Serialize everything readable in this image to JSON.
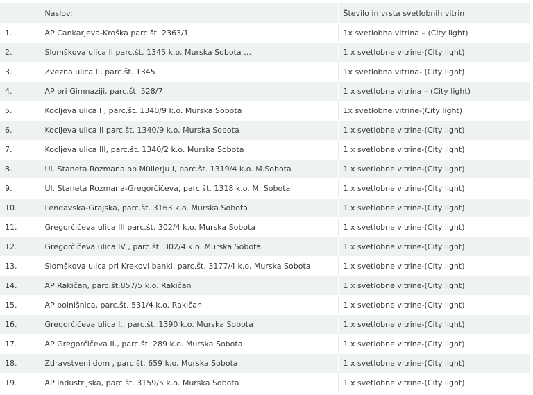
{
  "table": {
    "headers": [
      "",
      "Naslov:",
      "Število in vrsta svetlobnih vitrin"
    ],
    "rows": [
      [
        "1.",
        "AP Cankarjeva-Kroška parc.št. 2363/1",
        "1x svetlobna vitrina – (City light)"
      ],
      [
        "2.",
        "Slomškova ulica II parc.št. 1345 k.o. Murska Sobota …",
        "1 x svetlobne vitrine-(City light)"
      ],
      [
        "3.",
        "Zvezna ulica II, parc.št. 1345",
        "1x svetlobna vitrina- (City light)"
      ],
      [
        "4.",
        "AP pri Gimnaziji, parc.št. 528/7",
        "1 x svetlobna vitrina – (City light)"
      ],
      [
        "5.",
        "Kocljeva ulica I , parc.št. 1340/9 k.o. Murska Sobota",
        "1x svetlobne vitrine-(City light)"
      ],
      [
        "6.",
        "Kocljeva ulica II parc.št. 1340/9 k.o. Murska Sobota",
        "1 x svetlobne vitrine-(City light)"
      ],
      [
        "7.",
        "Kocljeva ulica III, parc.št. 1340/2 k.o. Murska Sobota",
        "1 x svetlobne vitrine-(City light)"
      ],
      [
        "8.",
        "Ul. Staneta Rozmana ob Müllerju I, parc.št. 1319/4 k.o. M.Sobota",
        "1 x svetlobne vitrine-(City light)"
      ],
      [
        "9.",
        "Ul. Staneta Rozmana-Gregorčičeva, parc.št. 1318 k.o. M. Sobota",
        "1 x svetlobne vitrine-(City light)"
      ],
      [
        "10.",
        "Lendavska-Grajska, parc.št. 3163 k.o. Murska Sobota",
        "1 x svetlobne vitrine-(City light)"
      ],
      [
        "11.",
        "Gregorčičeva ulica III parc.št. 302/4 k.o. Murska Sobota",
        "1 x svetlobne vitrine-(City light)"
      ],
      [
        "12.",
        "Gregorčičeva ulica IV , parc.št. 302/4 k.o. Murska Sobota",
        "1 x svetlobne vitrine-(City light)"
      ],
      [
        "13.",
        "Slomškova ulica pri Krekovi banki, parc.št. 3177/4 k.o. Murska Sobota",
        "1 x svetlobne vitrine-(City light)"
      ],
      [
        "14.",
        "AP Rakičan, parc.št.857/5 k.o. Rakičan",
        "1 x svetlobne vitrine-(City light)"
      ],
      [
        "15.",
        "AP bolnišnica, parc.št. 531/4 k.o. Rakičan",
        "1 x svetlobne vitrine-(City light)"
      ],
      [
        "16.",
        "Gregorčičeva ulica I., parc.št. 1390 k.o. Murska Sobota",
        "1 x svetlobne vitrine-(City light)"
      ],
      [
        "17.",
        "AP Gregorčičeva II., parc.št. 289 k.o. Murska Sobota",
        "1 x svetlobne vitrine-(City light)"
      ],
      [
        "18.",
        "Zdravstveni dom , parc.št. 659 k.o. Murska Sobota",
        "1 x svetlobne vitrine-(City light)"
      ],
      [
        "19.",
        "AP Industrijska, parc.št. 3159/5 k.o. Murska Sobota",
        "1 x svetlobne vitrine-(City light)"
      ]
    ]
  }
}
